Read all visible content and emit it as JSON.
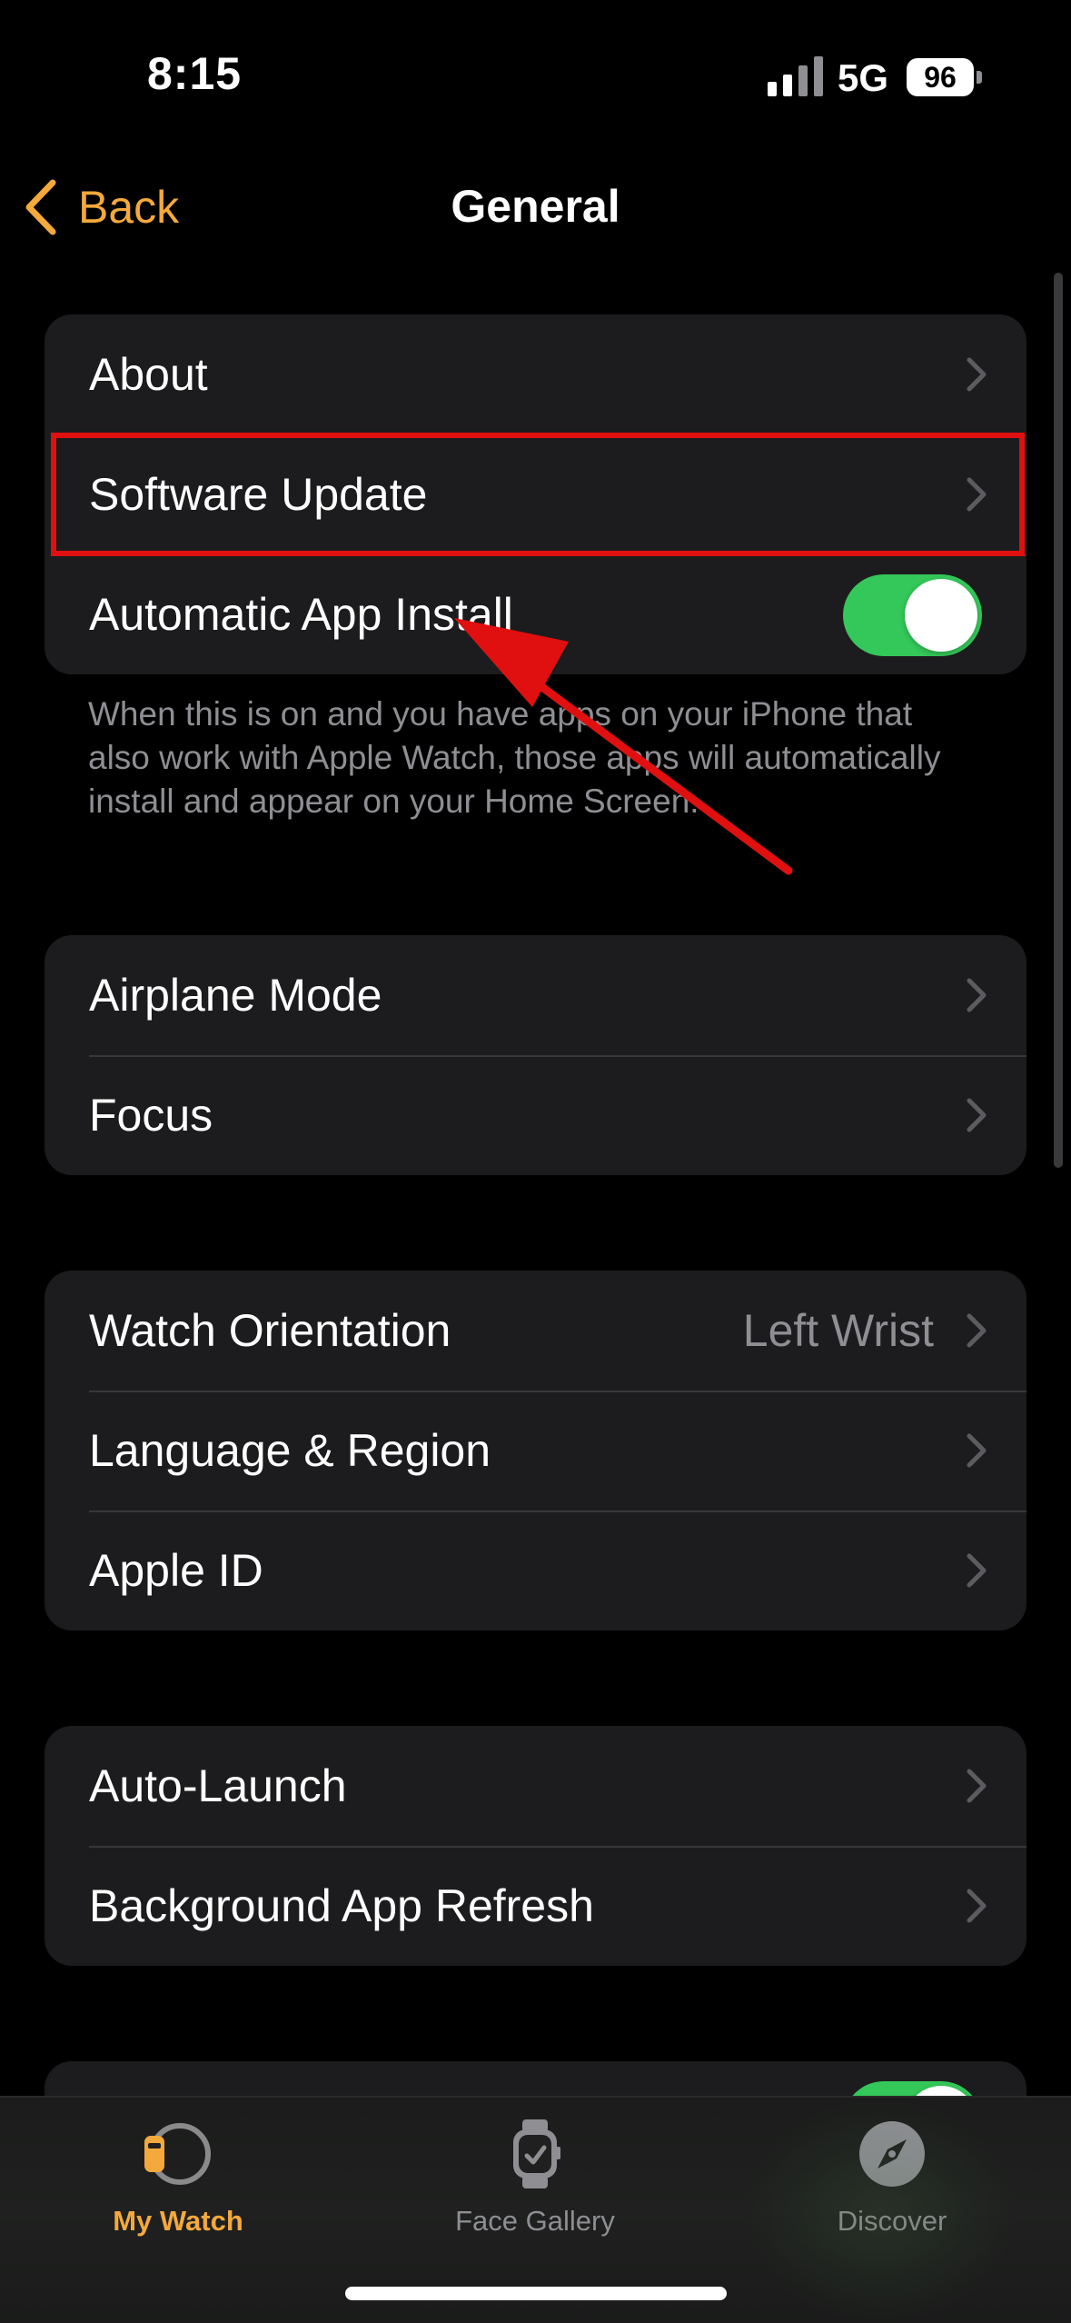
{
  "status_bar": {
    "time": "8:15",
    "network": "5G",
    "battery": "96"
  },
  "nav": {
    "back_label": "Back",
    "title": "General"
  },
  "groups": [
    {
      "rows": [
        {
          "label": "About",
          "type": "chevron"
        },
        {
          "label": "Software Update",
          "type": "chevron",
          "highlighted": true
        },
        {
          "label": "Automatic App Install",
          "type": "toggle",
          "on": true
        }
      ]
    },
    {
      "rows": [
        {
          "label": "Airplane Mode",
          "type": "chevron"
        },
        {
          "label": "Focus",
          "type": "chevron"
        }
      ]
    },
    {
      "rows": [
        {
          "label": "Watch Orientation",
          "value": "Left Wrist",
          "type": "chevron"
        },
        {
          "label": "Language & Region",
          "type": "chevron"
        },
        {
          "label": "Apple ID",
          "type": "chevron"
        }
      ]
    },
    {
      "rows": [
        {
          "label": "Auto-Launch",
          "type": "chevron"
        },
        {
          "label": "Background App Refresh",
          "type": "chevron"
        }
      ]
    }
  ],
  "footnote": "When this is on and you have apps on your iPhone that also work with Apple Watch, those apps will automatically install and appear on your Home Screen.",
  "tabs": [
    {
      "label": "My Watch",
      "icon": "watch-face-icon",
      "active": true
    },
    {
      "label": "Face Gallery",
      "icon": "watch-icon",
      "active": false
    },
    {
      "label": "Discover",
      "icon": "compass-icon",
      "active": false
    }
  ],
  "colors": {
    "accent": "#f4a93c",
    "toggle_on": "#34c759",
    "cell_background": "#1c1c1e",
    "annotation": "#e01010"
  }
}
